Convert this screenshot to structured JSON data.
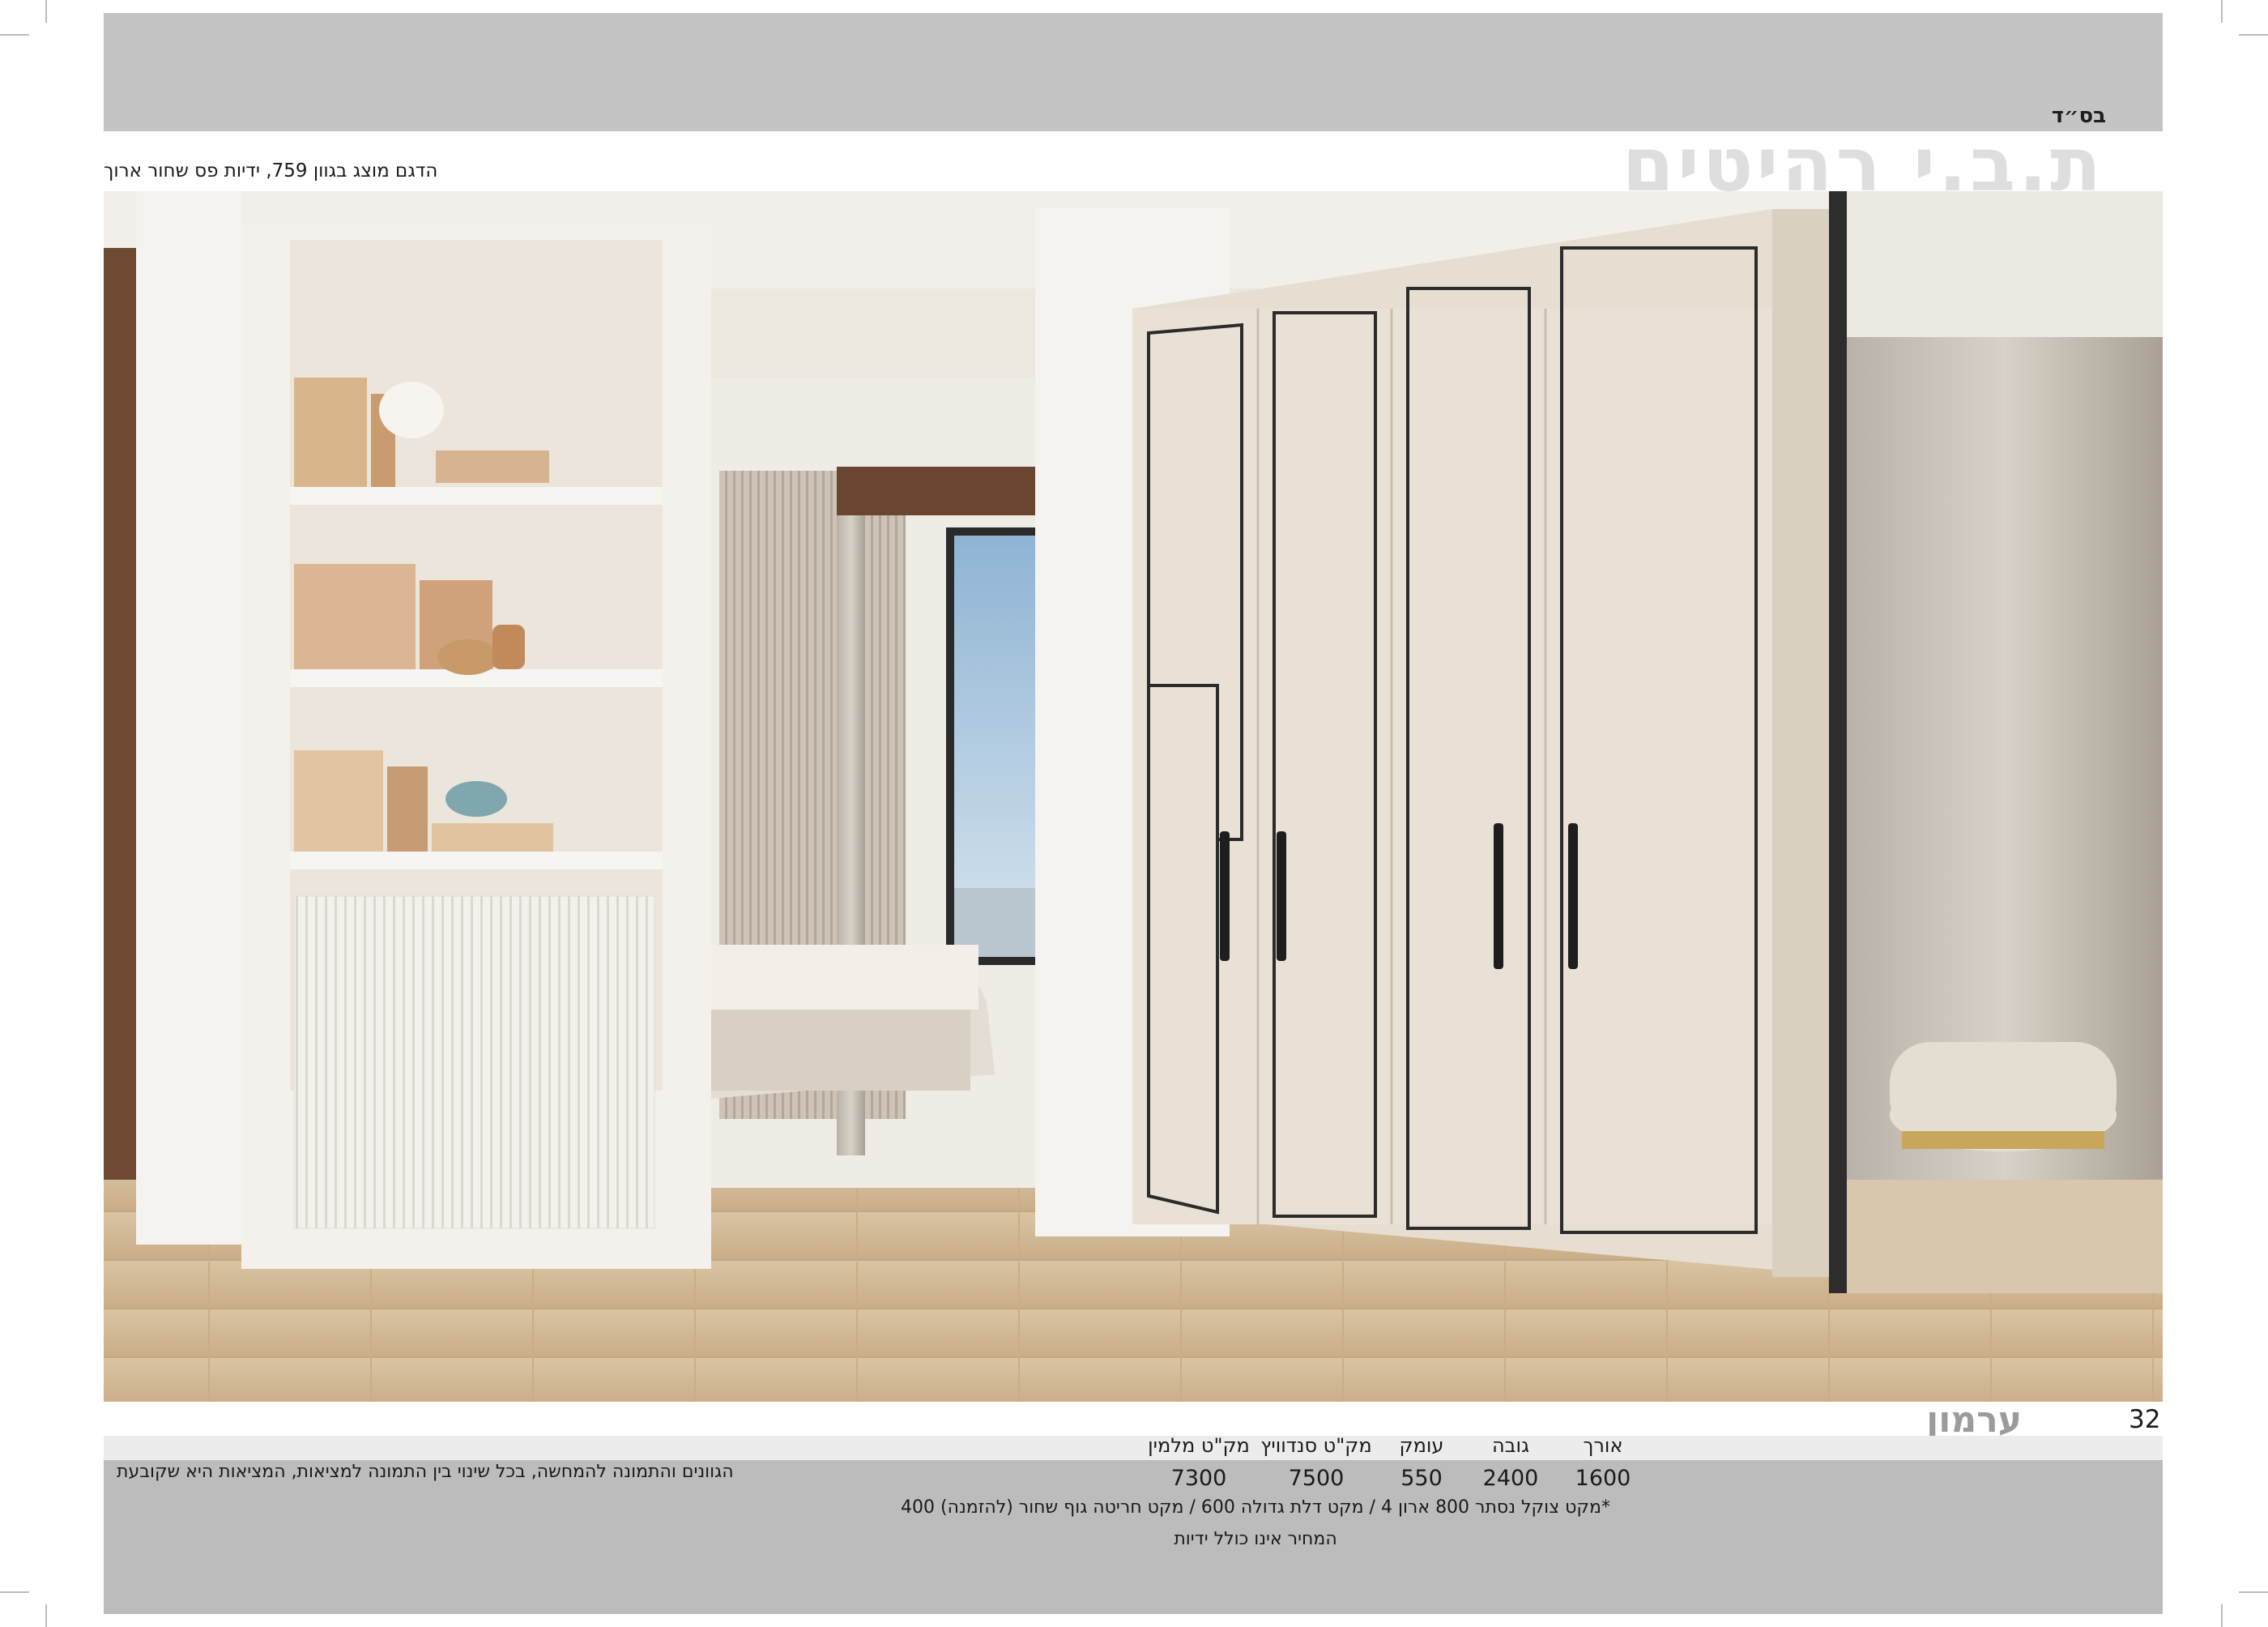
{
  "header": {
    "bsd": "בס״ד",
    "brand": "ת.ב.י רהיטים",
    "caption": "הדגם מוצג בגוון 759, ידיות פס שחור ארוך"
  },
  "photo": {
    "subject": "wardrobe-room-scene"
  },
  "footer": {
    "page_number": "32",
    "model_name": "ערמון",
    "disclaimer": "הגוונים והתמונה להמחשה, בכל שינוי בין התמונה למציאות, המציאות היא שקובעת",
    "table": {
      "headers": [
        "אורך",
        "גובה",
        "עומק",
        "מק\"ט סנדוויץ",
        "מק\"ט מלמין"
      ],
      "values": [
        "1600",
        "2400",
        "550",
        "7500",
        "7300"
      ]
    },
    "note_1": "*מקט צוקל נסתר 800 ארון 4 / מקט דלת גדולה 600 / מקט חריטה גוף שחור (להזמנה) 400",
    "note_2": "המחיר אינו כולל ידיות"
  },
  "colors": {
    "band_gray": "#c4c4c4",
    "brand_text": "#dedede",
    "model_text": "#9b9b9b",
    "wardrobe": "#e9e1d5",
    "floor": "#d8c3a3"
  }
}
